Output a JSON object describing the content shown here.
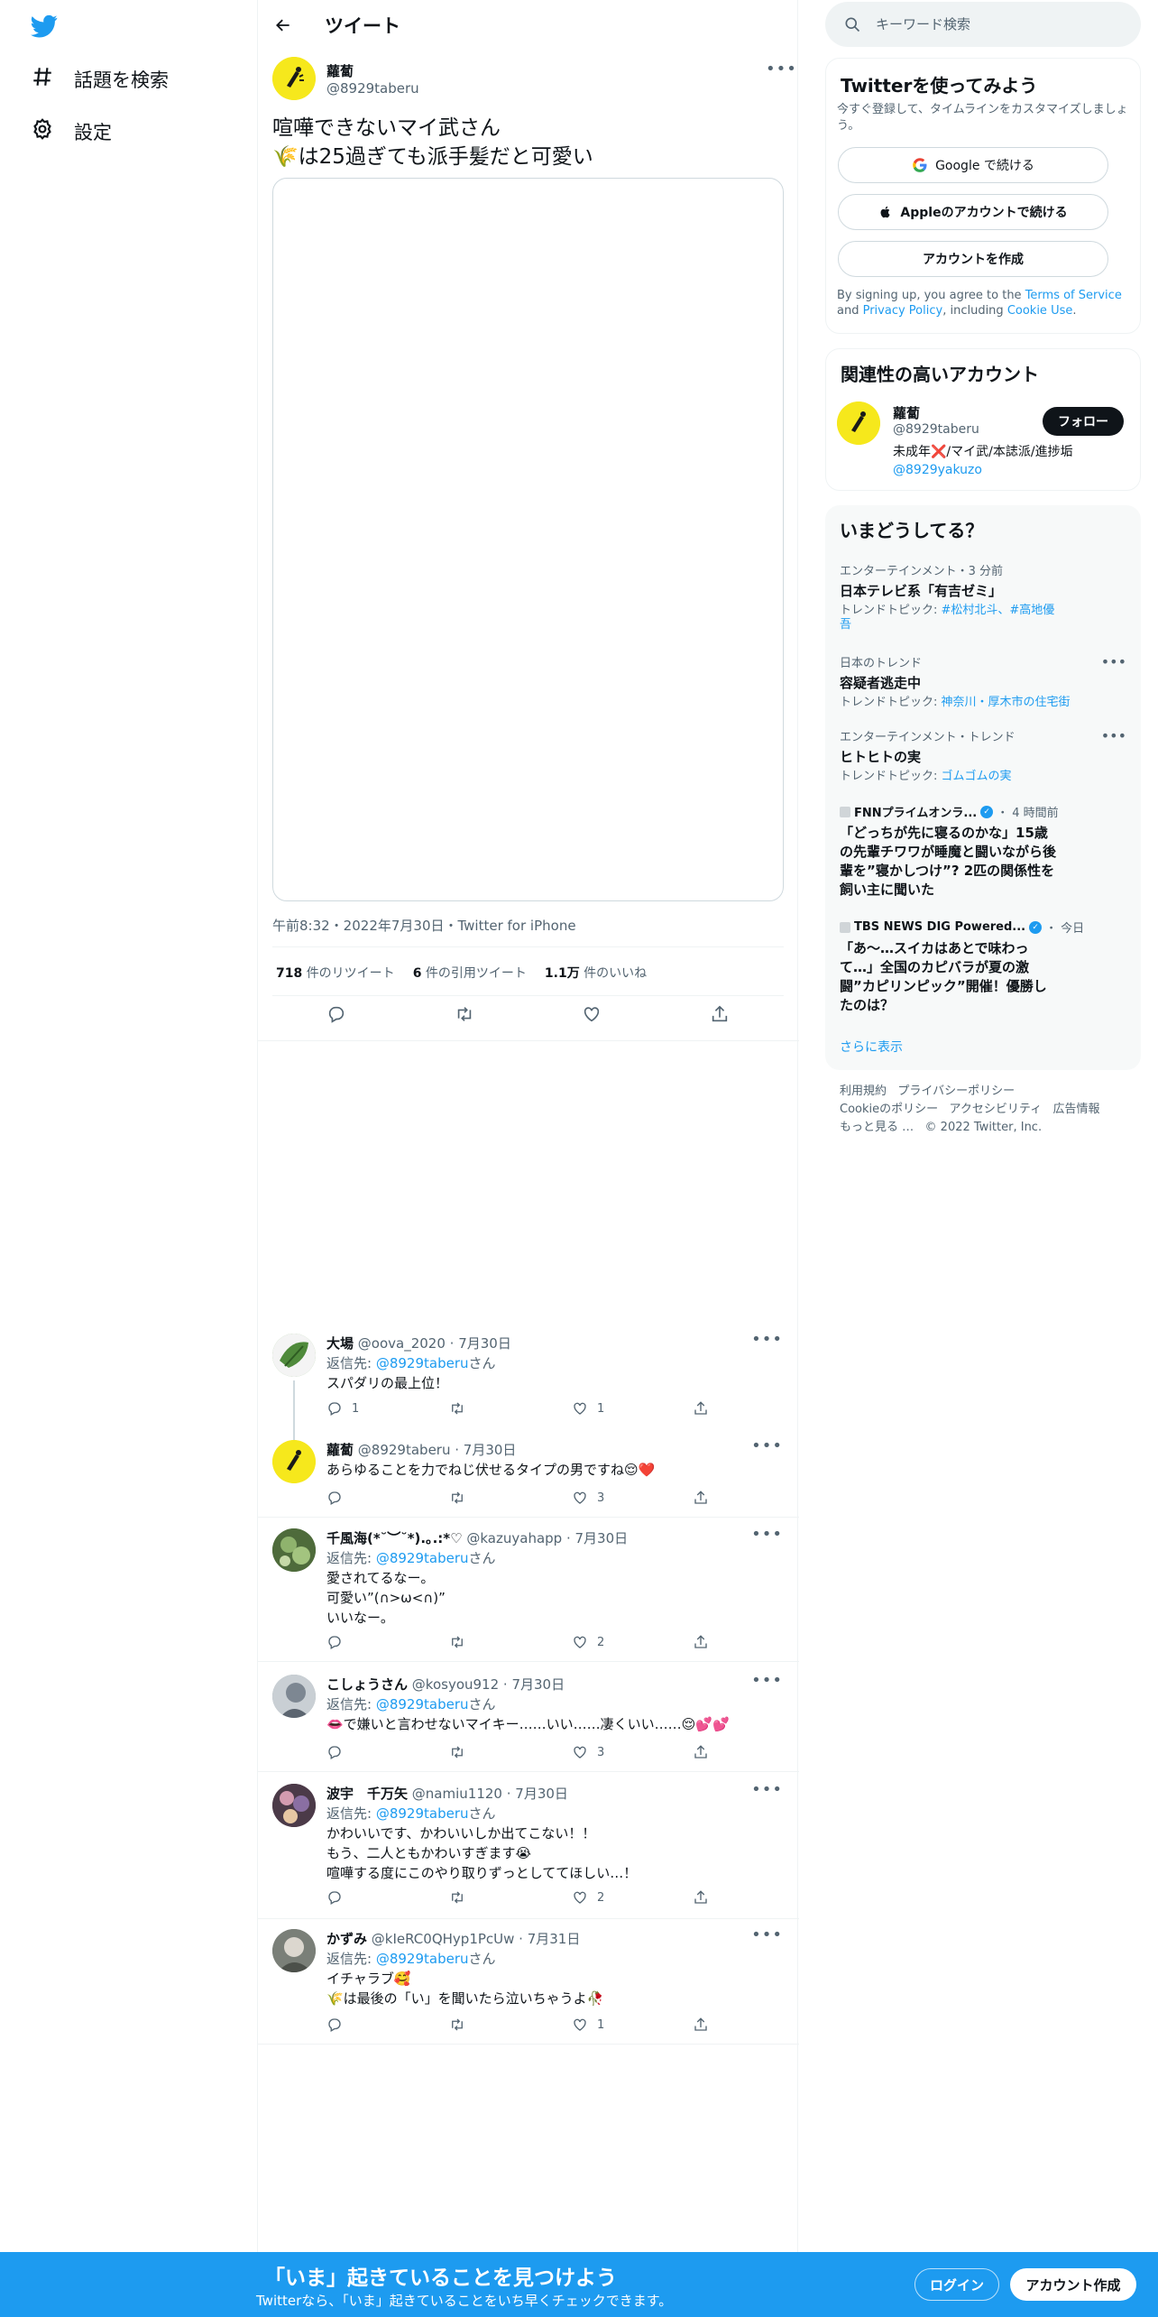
{
  "nav": {
    "items": [
      {
        "label": "話題を検索",
        "icon": "hashtag-icon"
      },
      {
        "label": "設定",
        "icon": "gear-icon"
      }
    ]
  },
  "header": {
    "title": "ツイート"
  },
  "tweet": {
    "name": "蘿蔔",
    "handle": "@8929taberu",
    "text_line1": "喧嘩できないマイ武さん",
    "text_line2": "🌾は25過ぎても派手髪だと可愛い",
    "meta": "午前8:32・2022年7月30日・Twitter for iPhone",
    "retweets_num": "718",
    "retweets_label": "件のリツイート",
    "quotes_num": "6",
    "quotes_label": "件の引用ツイート",
    "likes_num": "1.1万",
    "likes_label": "件のいいね"
  },
  "replies": [
    {
      "name": "大場",
      "handle": "@oova_2020",
      "date": "7月30日",
      "reply_to_prefix": "返信先: ",
      "reply_to": "@8929taberu",
      "reply_to_suffix": "さん",
      "text": "スパダリの最上位！",
      "replies": "1",
      "retweets": "",
      "likes": "1"
    },
    {
      "name": "蘿蔔",
      "handle": "@8929taberu",
      "date": "7月30日",
      "text": "あらゆることを力でねじ伏せるタイプの男ですね😌❤️",
      "replies": "",
      "retweets": "",
      "likes": "3"
    },
    {
      "name": "千風海(*˘︶˘*).｡.:*♡",
      "handle": "@kazuyahapp",
      "date": "7月30日",
      "reply_to_prefix": "返信先: ",
      "reply_to": "@8929taberu",
      "reply_to_suffix": "さん",
      "text": "愛されてるなー。\n可愛い”(∩>ω<∩)”\nいいなー。",
      "replies": "",
      "retweets": "",
      "likes": "2"
    },
    {
      "name": "こしょうさん",
      "handle": "@kosyou912",
      "date": "7月30日",
      "reply_to_prefix": "返信先: ",
      "reply_to": "@8929taberu",
      "reply_to_suffix": "さん",
      "text": "👄で嫌いと言わせないマイキー……いい……凄くいい……😌💕💕",
      "replies": "",
      "retweets": "",
      "likes": "3"
    },
    {
      "name": "波宇　千万矢",
      "handle": "@namiu1120",
      "date": "7月30日",
      "reply_to_prefix": "返信先: ",
      "reply_to": "@8929taberu",
      "reply_to_suffix": "さん",
      "text": "かわいいです、かわいいしか出てこない！！\nもう、二人ともかわいすぎます😭\n喧嘩する度にこのやり取りずっとしててほしい…！",
      "replies": "",
      "retweets": "",
      "likes": "2"
    },
    {
      "name": "かずみ",
      "handle": "@kIeRC0QHyp1PcUw",
      "date": "7月31日",
      "reply_to_prefix": "返信先: ",
      "reply_to": "@8929taberu",
      "reply_to_suffix": "さん",
      "text": "イチャラブ🥰\n🌾は最後の「い」を聞いたら泣いちゃうよ🥀",
      "replies": "",
      "retweets": "",
      "likes": "1"
    }
  ],
  "search": {
    "placeholder": "キーワード検索"
  },
  "signup_card": {
    "title": "Twitterを使ってみよう",
    "subtitle": "今すぐ登録して、タイムラインをカスタマイズしましょう。",
    "google_label": "Google で続ける",
    "apple_label": "Appleのアカウントで続ける",
    "create_label": "アカウントを作成",
    "legal_prefix": "By signing up, you agree to the ",
    "terms": "Terms of Service",
    "and": " and ",
    "privacy": "Privacy Policy",
    "including": ", including ",
    "cookie": "Cookie Use",
    "period": "."
  },
  "related": {
    "title": "関連性の高いアカウント",
    "name": "蘿蔔",
    "handle": "@8929taberu",
    "follow_label": "フォロー",
    "bio": "未成年❌/マイ武/本誌派/進捗垢",
    "bio_link": "@8929yakuzo"
  },
  "trends": {
    "title": "いまどうしてる？",
    "items": [
      {
        "category": "エンターテインメント・3 分前",
        "title": "日本テレビ系「有吉ゼミ」",
        "topic_prefix": "トレンドトピック: ",
        "topic": "#松村北斗、#高地優吾"
      },
      {
        "category": "日本のトレンド",
        "title": "容疑者逃走中",
        "topic_prefix": "トレンドトピック: ",
        "topic": "神奈川・厚木市の住宅街"
      },
      {
        "category": "エンターテインメント・トレンド",
        "title": "ヒトヒトの実",
        "topic_prefix": "トレンドトピック: ",
        "topic": "ゴムゴムの実"
      },
      {
        "source": "FNNプライムオンラ...",
        "time": "4 時間前",
        "title": "「どっちが先に寝るのかな」15歳の先輩チワワが睡魔と闘いながら後輩を”寝かしつけ”? 2匹の関係性を飼い主に聞いた"
      },
      {
        "source": "TBS NEWS DIG Powered...",
        "time": "今日",
        "title": "「あ～…スイカはあとで味わって…」全国のカピバラが夏の激闘”カピリンピック”開催！優勝したのは？"
      }
    ],
    "show_more": "さらに表示"
  },
  "footer": {
    "terms": "利用規約",
    "privacy": "プライバシーポリシー",
    "cookie": "Cookieのポリシー",
    "accessibility": "アクセシビリティ",
    "ads": "広告情報",
    "more": "もっと見る …",
    "copyright": "© 2022 Twitter, Inc."
  },
  "bottom_bar": {
    "title": "「いま」起きていることを見つけよう",
    "subtitle": "Twitterなら、「いま」起きていることをいち早くチェックできます。",
    "login": "ログイン",
    "signup": "アカウント作成"
  },
  "colors": {
    "accent": "#1d9bf0",
    "text": "#0f1419",
    "muted": "#536471",
    "avatar_yellow": "#f6e81c",
    "like_red": "#f91880"
  }
}
